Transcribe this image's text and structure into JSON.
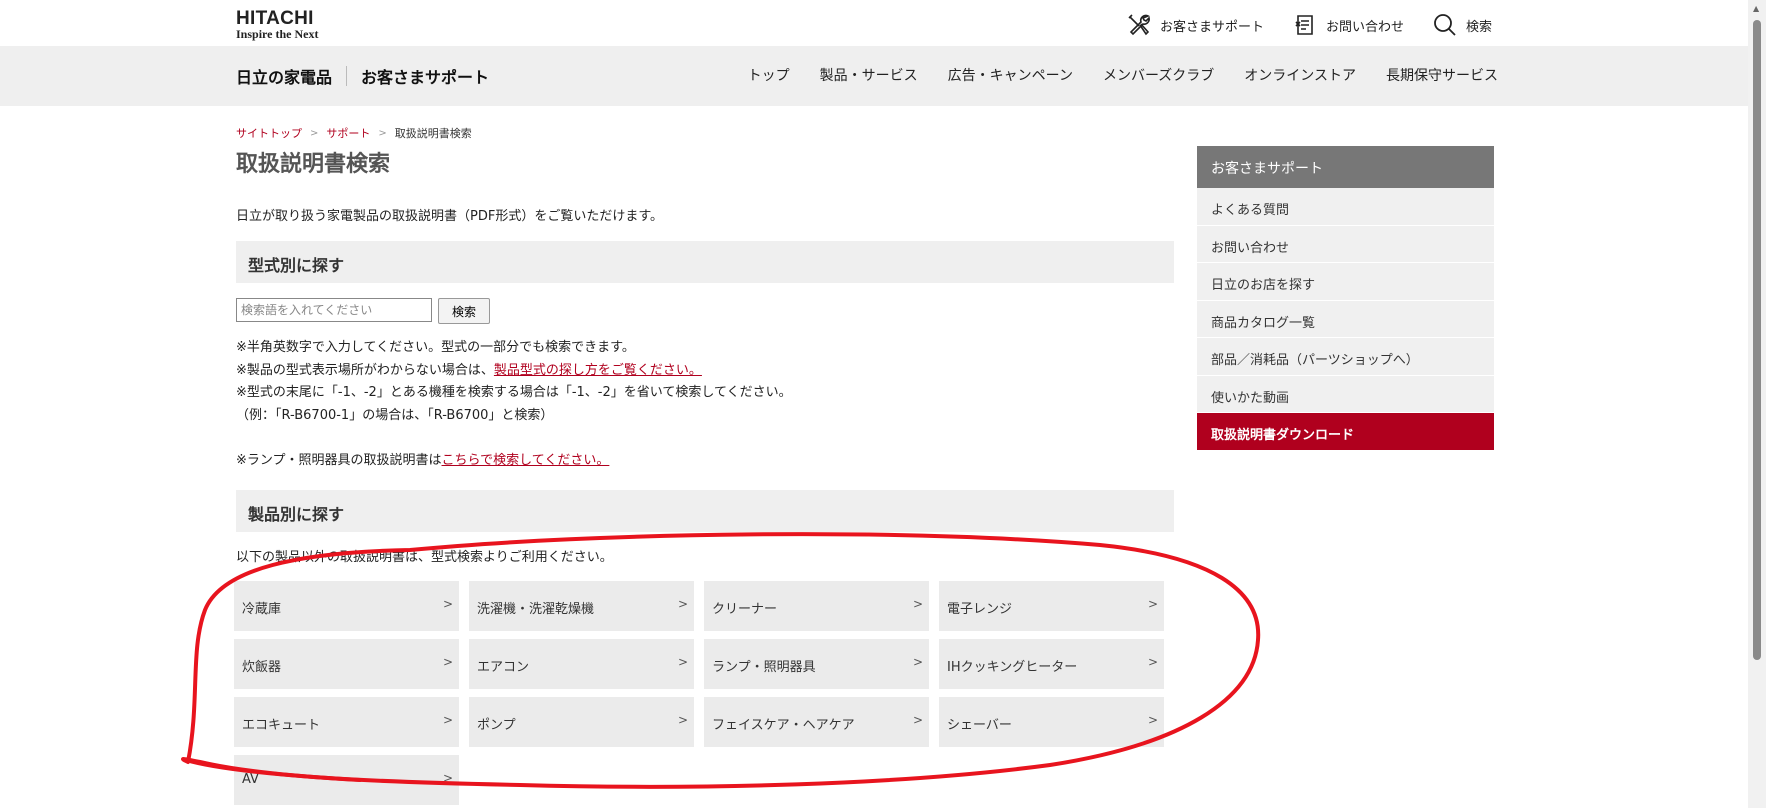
{
  "header": {
    "brand": "HITACHI",
    "tagline": "Inspire the Next",
    "util": {
      "support": "お客さまサポート",
      "contact": "お問い合わせ",
      "search": "検索"
    }
  },
  "gnav": {
    "site_title": "日立の家電品",
    "site_sub": "お客さまサポート",
    "items": [
      "トップ",
      "製品・サービス",
      "広告・キャンペーン",
      "メンバーズクラブ",
      "オンラインストア",
      "長期保守サービス"
    ]
  },
  "breadcrumb": {
    "items": [
      "サイトトップ",
      "サポート",
      "取扱説明書検索"
    ],
    "separator": ">"
  },
  "main": {
    "title": "取扱説明書検索",
    "intro": "日立が取り扱う家電製品の取扱説明書（PDF形式）をご覧いただけます。",
    "section_model": "型式別に探す",
    "search": {
      "placeholder": "検索語を入れてください",
      "button": "検索"
    },
    "notes": {
      "line1": "※半角英数字で入力してください。型式の一部分でも検索できます。",
      "line2_pre": "※製品の型式表示場所がわからない場合は、",
      "line2_link": "製品型式の探し方をご覧ください。",
      "line3": "※型式の末尾に「-1、-2」とある機種を検索する場合は「-1、-2」を省いて検索してください。",
      "line4": "（例：「R-B6700-1」の場合は、「R-B6700」と検索）",
      "line5_pre": "※ランプ・照明器具の取扱説明書は",
      "line5_link": "こちらで検索してください。"
    },
    "section_product": "製品別に探す",
    "product_intro": "以下の製品以外の取扱説明書は、型式検索よりご利用ください。",
    "products": [
      "冷蔵庫",
      "洗濯機・洗濯乾燥機",
      "クリーナー",
      "電子レンジ",
      "炊飯器",
      "エアコン",
      "ランプ・照明器具",
      "IHクッキングヒーター",
      "エコキュート",
      "ポンプ",
      "フェイスケア・ヘアケア",
      "シェーバー",
      "AV"
    ],
    "arrow": ">"
  },
  "sidebar": {
    "title": "お客さまサポート",
    "items": [
      "よくある質問",
      "お問い合わせ",
      "日立のお店を探す",
      "商品カタログ一覧",
      "部品／消耗品（パーツショップへ）",
      "使いかた動画",
      "取扱説明書ダウンロード"
    ],
    "active_index": 6
  },
  "colors": {
    "accent": "#b0001e",
    "annotation": "#e8141e",
    "nav_bg": "#efefef",
    "sidebar_head": "#777777"
  }
}
